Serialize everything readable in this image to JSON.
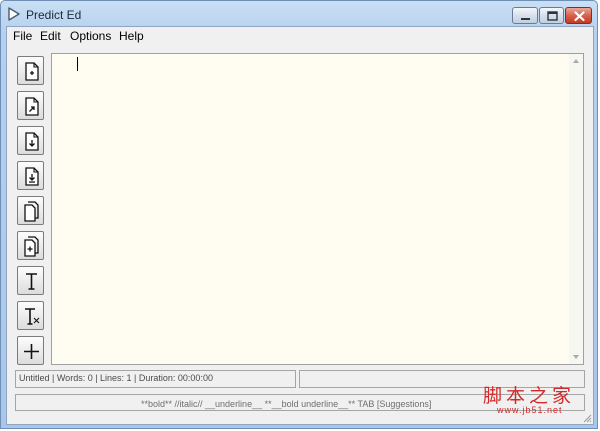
{
  "window": {
    "title": "Predict Ed"
  },
  "menu": [
    {
      "label": "File"
    },
    {
      "label": "Edit"
    },
    {
      "label": "Options"
    },
    {
      "label": "Help"
    }
  ],
  "toolbar": [
    {
      "icon": "new-document-icon"
    },
    {
      "icon": "open-document-icon"
    },
    {
      "icon": "save-document-icon"
    },
    {
      "icon": "save-as-document-icon"
    },
    {
      "icon": "copy-documents-icon"
    },
    {
      "icon": "add-document-icon"
    },
    {
      "icon": "text-format-icon"
    },
    {
      "icon": "clear-format-icon"
    },
    {
      "icon": "plus-icon"
    }
  ],
  "editor": {
    "content": ""
  },
  "status": {
    "info": "Untitled | Words: 0 | Lines: 1 | Duration: 00:00:00",
    "secondary": "",
    "hint": "**bold**   //italic//   __underline__   **__bold underline__**   TAB [Suggestions]"
  },
  "watermark": {
    "main": "脚本之家",
    "sub": "www.jb51.net"
  },
  "colors": {
    "editor_background": "#fffcf2",
    "title_bar": "#b5d0ee",
    "close_button": "#c23a24",
    "watermark": "#d22a2a"
  }
}
